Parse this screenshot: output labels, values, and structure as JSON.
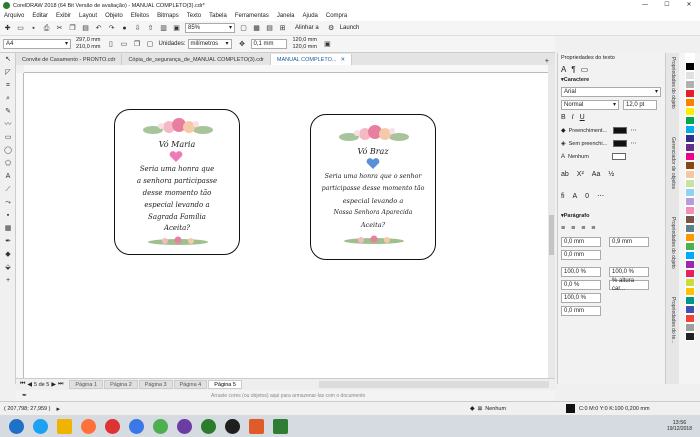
{
  "window": {
    "title": "CorelDRAW 2018 (64 Bit Versão de avaliação) - MANUAL COMPLETO(3).cdr*"
  },
  "menu": [
    "Arquivo",
    "Editar",
    "Exibir",
    "Layout",
    "Objeto",
    "Efeitos",
    "Bitmaps",
    "Texto",
    "Tabela",
    "Ferramentas",
    "Janela",
    "Ajuda",
    "Compra"
  ],
  "toolbar1": {
    "zoom": "85%",
    "snap": "Alinhar a",
    "launch": "Launch"
  },
  "toolbar2": {
    "paper": "A4",
    "width": "297,0 mm",
    "height": "210,0 mm",
    "units_label": "Unidades:",
    "units": "milímetros",
    "nudge": "0,1 mm",
    "dup_x": "120,0 mm",
    "dup_y": "120,0 mm"
  },
  "doc_tabs": [
    "Convite de Casamento - PRONTO.cdr",
    "Cópia_de_segurança_de_MANUAL COMPLETO(3).cdr",
    "MANUAL COMPLETO..."
  ],
  "card_left": {
    "name": "Vó Maria",
    "line1": "Seria uma honra que",
    "line2": "a senhora participasse",
    "line3": "desse momento tão",
    "line4": "especial levando a",
    "line5": "Sagrada Família",
    "line6": "Aceita?"
  },
  "card_right": {
    "name": "Vó Braz",
    "line1": "Seria uma honra que o senhor",
    "line2": "participasse desse momento tão",
    "line3": "especial levando a",
    "line4": "Nossa Senhora Aparecida",
    "line5": "Aceita?"
  },
  "page_nav": {
    "counter": "5 de 5",
    "tabs": [
      "Página 1",
      "Página 2",
      "Página 3",
      "Página 4",
      "Página 5"
    ]
  },
  "docker": {
    "title": "Propriedades do texto",
    "section_char": "Caractere",
    "font": "Arial",
    "style": "Normal",
    "size": "12,0 pt",
    "fill1": "Preenchiment...",
    "fill2": "Sem preenchi...",
    "outline": "Nenhum",
    "section_para": "Parágrafo",
    "indent1": "0,0 mm",
    "indent2": "0,9 mm",
    "indent3": "0,0 mm",
    "spacing1": "100,0 %",
    "spacing2": "100,0 %",
    "spacing3": "0,0 %",
    "spacing4": "% altura car...",
    "spacing5": "100,0 %",
    "spacing6": "0,0 mm"
  },
  "vertical_tabs": [
    "Propriedades do objeto",
    "Gerenciador de objetos",
    "Propriedades do objeto",
    "Propriedades do te..."
  ],
  "status": {
    "coords": "( 207,798; 27,959 )",
    "hint": "Arraste cores (ou objetos) aqui para armazenar-las com o documento",
    "fill": "Nenhum",
    "color_info": "C:0 M:0 Y:0 K:100  0,200 mm"
  },
  "taskbar": {
    "time": "13:56",
    "date": "19/12/2018"
  },
  "colors": {
    "heart_left": "#f07ab8",
    "heart_right": "#5b8fd9",
    "accent": "#1a5ca8"
  },
  "palette": [
    "#ffffff",
    "#000000",
    "#e0e0e0",
    "#b0b0b0",
    "#e31e24",
    "#ff7f00",
    "#ffed00",
    "#00a650",
    "#00aeef",
    "#2e3192",
    "#662d91",
    "#ec008c",
    "#8b4513",
    "#f7c8a0",
    "#c6e3a0",
    "#8fd3f4",
    "#b39ddb",
    "#f48fb1",
    "#795548",
    "#607d8b",
    "#ff9800",
    "#4caf50",
    "#03a9f4",
    "#9c27b0",
    "#e91e63",
    "#cddc39",
    "#ffc107",
    "#009688",
    "#3f51b5",
    "#f44336",
    "#9e9e9e",
    "#212121"
  ]
}
